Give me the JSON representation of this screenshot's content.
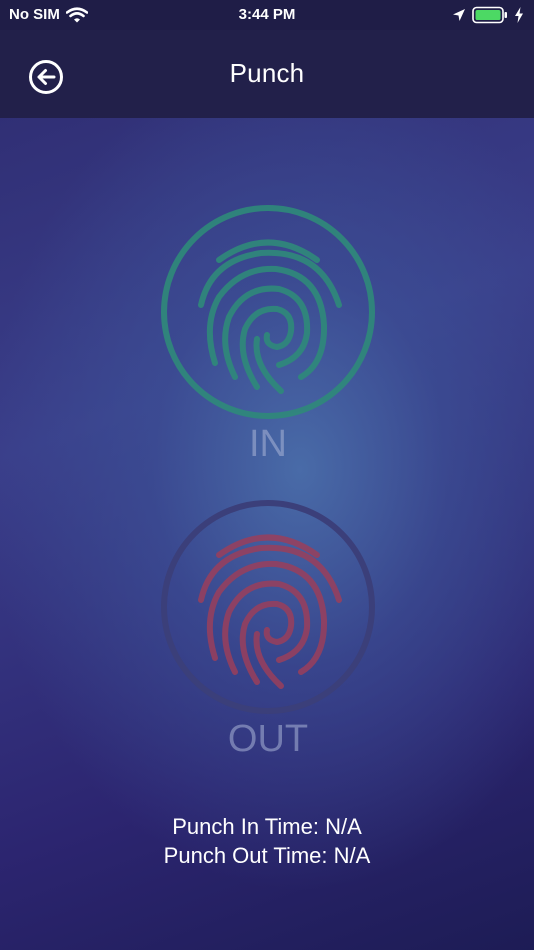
{
  "status_bar": {
    "carrier": "No SIM",
    "time": "3:44 PM",
    "icons": [
      "wifi-icon",
      "location-arrow-icon",
      "battery-icon",
      "charging-bolt-icon"
    ]
  },
  "header": {
    "title": "Punch",
    "back_icon": "back-arrow-circle-icon"
  },
  "punch_in": {
    "label": "IN",
    "icon": "fingerprint-icon",
    "color": "#2f8a7a"
  },
  "punch_out": {
    "label": "OUT",
    "icon": "fingerprint-icon",
    "color": "#9a3f5c"
  },
  "times": {
    "punch_in_text": "Punch In Time: N/A",
    "punch_out_text": "Punch Out Time: N/A"
  },
  "colors": {
    "status_bar_bg": "#1f1d47",
    "nav_bar_bg": "#22204a",
    "out_ring": "#3b3f7a"
  }
}
